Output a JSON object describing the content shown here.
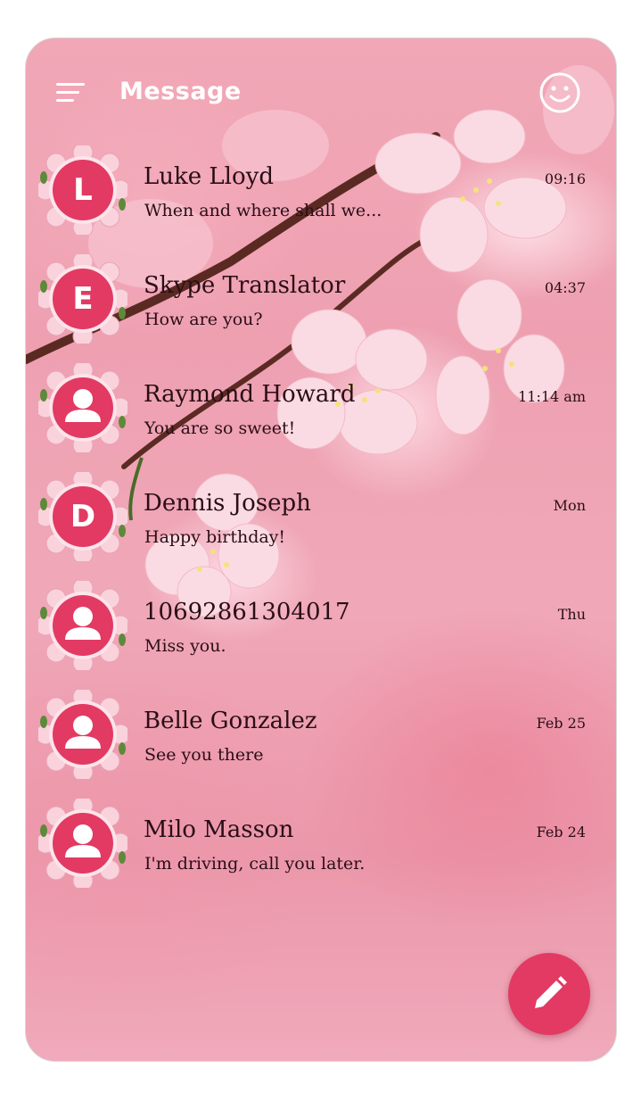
{
  "header": {
    "title": "Message",
    "menu_icon": "hamburger-menu-icon",
    "theme_icon": "smiley-face-icon"
  },
  "conversations": [
    {
      "name": "Luke Lloyd",
      "preview": "When and where shall we...",
      "time": "09:16",
      "avatar": "L",
      "avatar_type": "letter"
    },
    {
      "name": "Skype Translator",
      "preview": "How are you?",
      "time": "04:37",
      "avatar": "E",
      "avatar_type": "letter"
    },
    {
      "name": "Raymond Howard",
      "preview": "You are so sweet!",
      "time": "11:14 am",
      "avatar": "",
      "avatar_type": "person-icon"
    },
    {
      "name": "Dennis Joseph",
      "preview": "Happy birthday!",
      "time": "Mon",
      "avatar": "D",
      "avatar_type": "letter"
    },
    {
      "name": "10692861304017",
      "preview": "Miss you.",
      "time": "Thu",
      "avatar": "",
      "avatar_type": "person-icon"
    },
    {
      "name": "Belle Gonzalez",
      "preview": "See you there",
      "time": "Feb 25",
      "avatar": "",
      "avatar_type": "person-icon"
    },
    {
      "name": "Milo Masson",
      "preview": "I'm driving, call you later.",
      "time": "Feb 24",
      "avatar": "",
      "avatar_type": "person-icon"
    }
  ],
  "compose_button": {
    "icon": "pencil-icon"
  },
  "colors": {
    "accent": "#e23a63",
    "text": "#2a0e16",
    "header_text": "#ffffff"
  }
}
